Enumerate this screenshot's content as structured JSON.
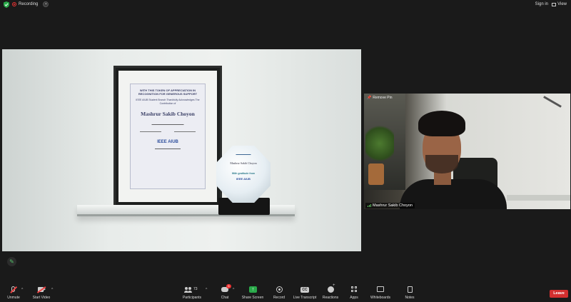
{
  "topbar": {
    "recording_label": "Recording",
    "signin_label": "Sign in",
    "view_label": "View"
  },
  "colors": {
    "background": "#1a1a1a",
    "security_green": "#2aaa4a",
    "recording_red": "#e33333",
    "share_screen_green": "#2aaa4a",
    "leave_red": "#d32f2f",
    "mute_slash_red": "#e44444"
  },
  "shared_screen": {
    "certificate": {
      "heading": "WITH THIS TOKEN OF APPRECIATION IN RECOGNITION FOR GENEROUS SUPPORT",
      "subheading": "IEEE AIUB Student Branch Thankfully Acknowledges The Contribution of",
      "recipient_name": "Mashrur Sakib Choyon",
      "logo_text": "IEEE AIUB"
    },
    "trophy": {
      "name": "Mashrur Sakib Choyon",
      "gratitude_text": "With gratitude from",
      "logo_text": "IEEE AIUB"
    }
  },
  "video_tile": {
    "pin_label": "Remove Pin",
    "participant_name": "Mashrur Sakib Choyon"
  },
  "toolbar": {
    "unmute_label": "Unmute",
    "start_video_label": "Start Video",
    "participants_label": "Participants",
    "participants_count": "73",
    "chat_label": "Chat",
    "chat_badge": "5",
    "share_screen_label": "Share Screen",
    "record_label": "Record",
    "live_transcript_label": "Live Transcript",
    "reactions_label": "Reactions",
    "apps_label": "Apps",
    "whiteboards_label": "Whiteboards",
    "notes_label": "Notes",
    "leave_label": "Leave"
  },
  "icons": {
    "security": "shield-check-icon",
    "recording": "record-dot-icon",
    "annotate": "pencil-icon",
    "unmute": "microphone-muted-icon",
    "start_video": "camera-off-icon",
    "participants": "people-icon",
    "chat": "chat-bubble-icon",
    "share_screen": "share-arrow-icon",
    "record": "record-icon",
    "live_transcript": "cc-icon",
    "reactions": "smiley-plus-icon",
    "apps": "apps-grid-icon",
    "whiteboards": "whiteboard-icon",
    "notes": "notes-icon"
  }
}
